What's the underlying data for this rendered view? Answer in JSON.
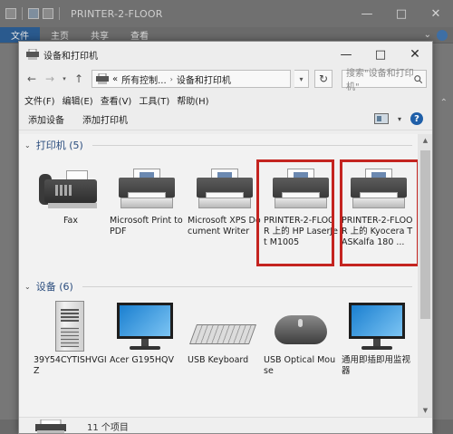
{
  "background_window": {
    "title": "PRINTER-2-FLOOR",
    "tabs": [
      "文件",
      "主页",
      "共享",
      "查看"
    ],
    "minimize": "—",
    "maximize": "□",
    "close": "✕"
  },
  "window": {
    "title": "设备和打印机",
    "minimize": "—",
    "maximize": "□",
    "close": "✕"
  },
  "address_bar": {
    "back": "←",
    "forward": "→",
    "up": "↑",
    "crumb_prefix": "«",
    "crumbs": [
      "所有控制...",
      "设备和打印机"
    ],
    "refresh": "↻",
    "search_placeholder": "搜索\"设备和打印机\""
  },
  "menu": {
    "items": [
      "文件(F)",
      "编辑(E)",
      "查看(V)",
      "工具(T)",
      "帮助(H)"
    ]
  },
  "commands": {
    "add_device": "添加设备",
    "add_printer": "添加打印机",
    "help": "?"
  },
  "groups": {
    "printers": {
      "header": "打印机 (5)",
      "items": [
        {
          "label": "Fax",
          "icon": "fax-icon"
        },
        {
          "label": "Microsoft Print to PDF",
          "icon": "printer-icon"
        },
        {
          "label": "Microsoft XPS Document Writer",
          "icon": "printer-icon"
        },
        {
          "label": "PRINTER-2-FLOOR 上的 HP LaserJet M1005",
          "icon": "printer-icon"
        },
        {
          "label": "PRINTER-2-FLOOR 上的 Kyocera TASKalfa 180 ...",
          "icon": "printer-icon"
        }
      ]
    },
    "devices": {
      "header": "设备 (6)",
      "items": [
        {
          "label": "39Y54CYTISHVGIZ",
          "icon": "computer-icon"
        },
        {
          "label": "Acer G195HQV",
          "icon": "monitor-icon"
        },
        {
          "label": "USB Keyboard",
          "icon": "keyboard-icon"
        },
        {
          "label": "USB Optical Mouse",
          "icon": "mouse-icon"
        },
        {
          "label": "通用即插即用监视器",
          "icon": "monitor-icon"
        }
      ]
    }
  },
  "status": {
    "count": "11 个项目"
  },
  "colors": {
    "highlight": "#c42420",
    "group_header": "#2b4d7e",
    "help": "#1f5fa8"
  }
}
